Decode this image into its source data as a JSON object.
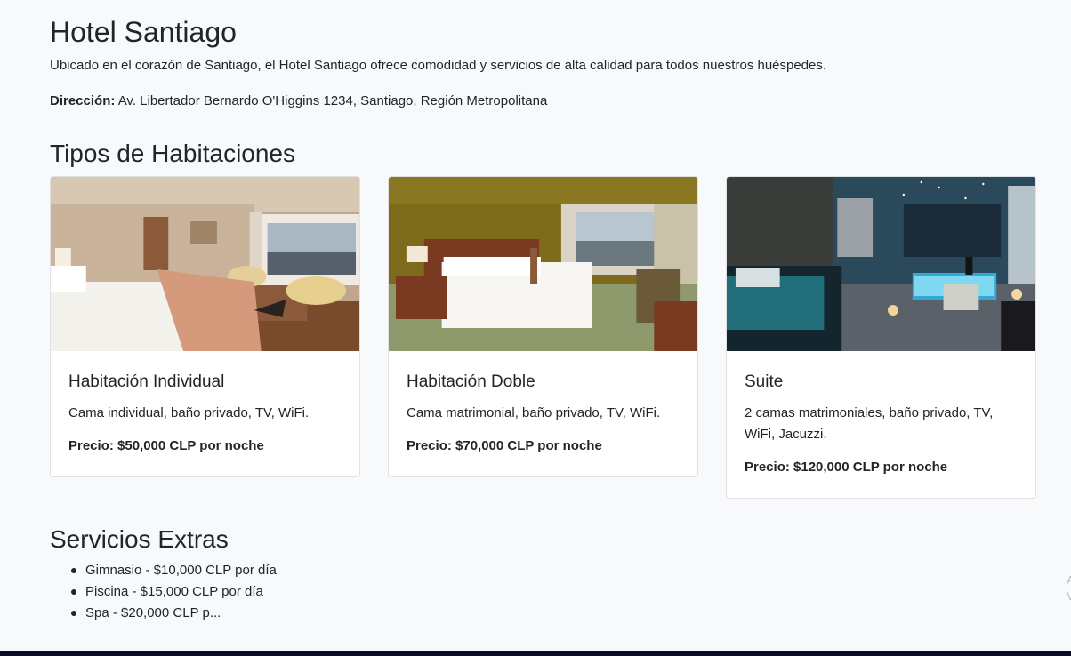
{
  "hotel": {
    "name": "Hotel Santiago",
    "description": "Ubicado en el corazón de Santiago, el Hotel Santiago ofrece comodidad y servicios de alta calidad para todos nuestros huéspedes.",
    "address_label": "Dirección:",
    "address_value": "Av. Libertador Bernardo O'Higgins 1234, Santiago, Región Metropolitana"
  },
  "rooms": {
    "title": "Tipos de Habitaciones",
    "items": [
      {
        "name": "Habitación Individual",
        "description": "Cama individual, baño privado, TV, WiFi.",
        "price": "Precio: $50,000 CLP por noche"
      },
      {
        "name": "Habitación Doble",
        "description": "Cama matrimonial, baño privado, TV, WiFi.",
        "price": "Precio: $70,000 CLP por noche"
      },
      {
        "name": "Suite",
        "description": "2 camas matrimoniales, baño privado, TV, WiFi, Jacuzzi.",
        "price": "Precio: $120,000 CLP por noche"
      }
    ]
  },
  "extras": {
    "title": "Servicios Extras",
    "items": [
      "Gimnasio - $10,000 CLP por día",
      "Piscina - $15,000 CLP por día",
      "Spa - $20,000 CLP p..."
    ]
  },
  "edge_text": "A V"
}
